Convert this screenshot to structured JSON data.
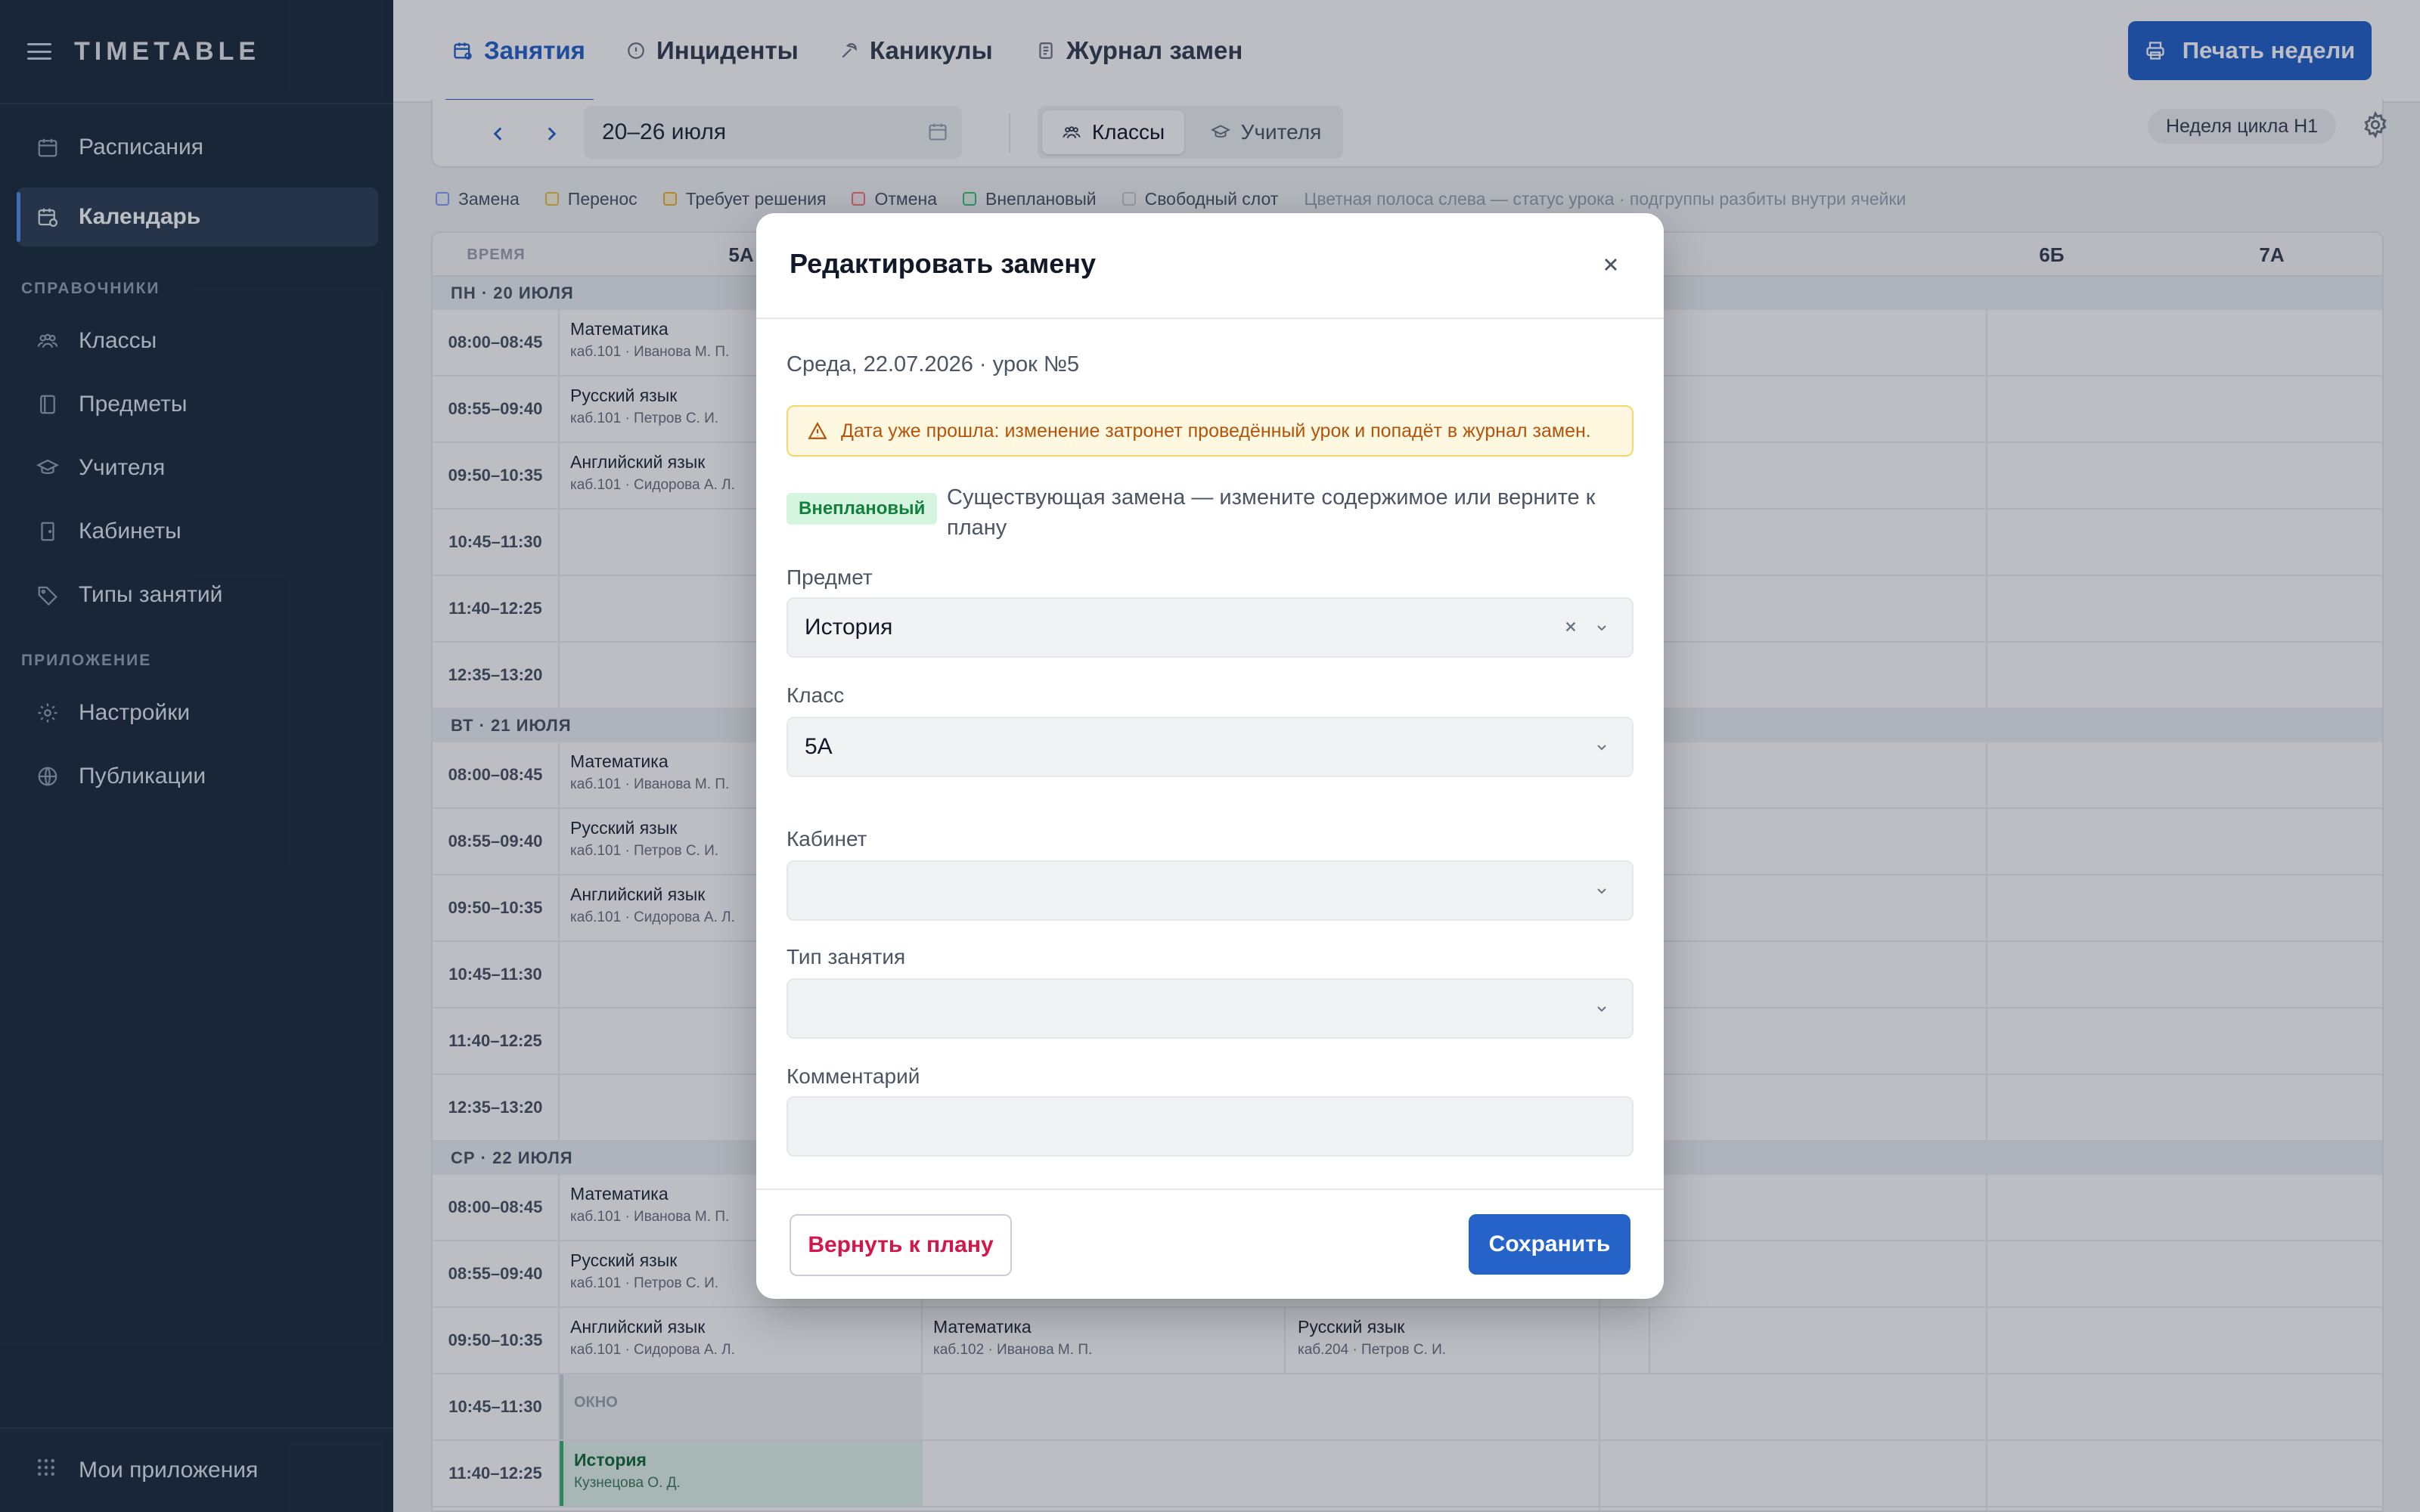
{
  "sidebar": {
    "brand": "TIMETABLE",
    "items": [
      {
        "label": "Расписания"
      },
      {
        "label": "Календарь"
      },
      {
        "label": "Классы"
      },
      {
        "label": "Предметы"
      },
      {
        "label": "Учителя"
      },
      {
        "label": "Кабинеты"
      },
      {
        "label": "Типы занятий"
      },
      {
        "label": "Настройки"
      },
      {
        "label": "Публикации"
      }
    ],
    "section_refs": "СПРАВОЧНИКИ",
    "section_apps": "ПРИЛОЖЕНИЕ",
    "bottom": "Мои приложения"
  },
  "topbar": {
    "tabs": [
      {
        "label": "Занятия"
      },
      {
        "label": "Инциденты"
      },
      {
        "label": "Каникулы"
      },
      {
        "label": "Журнал замен"
      }
    ],
    "print_label": "Печать недели"
  },
  "toolbar": {
    "prev": "‹",
    "next": "›",
    "date_range": "20–26 июля",
    "seg_classes": "Классы",
    "seg_teachers": "Учителя",
    "cycle": "Неделя цикла Н1"
  },
  "legend": {
    "items": [
      {
        "label": "Замена",
        "color": "#8b9df0"
      },
      {
        "label": "Перенос",
        "color": "#e9c04a"
      },
      {
        "label": "Требует решения",
        "color": "#e9b23a"
      },
      {
        "label": "Отмена",
        "color": "#ef7b7b"
      },
      {
        "label": "Внеплановый",
        "color": "#43c07a"
      },
      {
        "label": "Свободный слот",
        "color": "#c7cbd1"
      }
    ],
    "note": "Цветная полоса слева — статус урока · подгруппы разбиты внутри ячейки"
  },
  "grid": {
    "time_header": "ВРЕМЯ",
    "columns": [
      "5А",
      "6Б",
      "7А"
    ],
    "days": [
      {
        "label": "ПН · 20 ИЮЛЯ",
        "rows": [
          {
            "time": "08:00–08:45",
            "subject": "Математика",
            "sub": "каб.101 · Иванова М. П."
          },
          {
            "time": "08:55–09:40",
            "subject": "Русский язык",
            "sub": "каб.101 · Петров С. И."
          },
          {
            "time": "09:50–10:35",
            "subject": "Английский язык",
            "sub": "каб.101 · Сидорова А. Л."
          },
          {
            "time": "10:45–11:30",
            "subject": "",
            "sub": ""
          },
          {
            "time": "11:40–12:25",
            "subject": "",
            "sub": ""
          },
          {
            "time": "12:35–13:20",
            "subject": "",
            "sub": ""
          }
        ]
      },
      {
        "label": "ВТ · 21 ИЮЛЯ",
        "rows": [
          {
            "time": "08:00–08:45",
            "subject": "Математика",
            "sub": "каб.101 · Иванова М. П."
          },
          {
            "time": "08:55–09:40",
            "subject": "Русский язык",
            "sub": "каб.101 · Петров С. И."
          },
          {
            "time": "09:50–10:35",
            "subject": "Английский язык",
            "sub": "каб.101 · Сидорова А. Л."
          },
          {
            "time": "10:45–11:30",
            "subject": "",
            "sub": ""
          },
          {
            "time": "11:40–12:25",
            "subject": "",
            "sub": ""
          },
          {
            "time": "12:35–13:20",
            "subject": "",
            "sub": ""
          }
        ]
      },
      {
        "label": "СР · 22 ИЮЛЯ",
        "rows": [
          {
            "time": "08:00–08:45",
            "subject": "Математика",
            "sub": "каб.101 · Иванова М. П."
          },
          {
            "time": "08:55–09:40",
            "subject": "Русский язык",
            "sub": "каб.101 · Петров С. И."
          },
          {
            "time": "09:50–10:35",
            "subject": "Английский язык",
            "sub": "каб.101 · Сидорова А. Л."
          },
          {
            "time": "10:45–11:30",
            "subject": "ОКНО",
            "sub": ""
          },
          {
            "time": "11:40–12:25",
            "subject": "История",
            "sub": "Кузнецова О. Д."
          }
        ]
      }
    ],
    "wed_col2": {
      "subject": "Математика",
      "sub": "каб.102 · Иванова М. П."
    },
    "wed_col3": {
      "subject": "Русский язык",
      "sub": "каб.204 · Петров С. И."
    }
  },
  "modal": {
    "title": "Редактировать замену",
    "date_line": "Среда, 22.07.2026 · урок №5",
    "warning": "Дата уже прошла: изменение затронет проведённый урок и попадёт в журнал замен.",
    "badge": "Внеплановый",
    "description": "Существующая замена — измените содержимое или верните к плану",
    "subject_label": "Предмет",
    "subject_value": "История",
    "class_label": "Класс",
    "class_value": "5А",
    "room_label": "Кабинет",
    "room_value": "",
    "type_label": "Тип занятия",
    "type_value": "",
    "comment_label": "Комментарий",
    "comment_value": "",
    "revert_label": "Вернуть к плану",
    "save_label": "Сохранить"
  }
}
